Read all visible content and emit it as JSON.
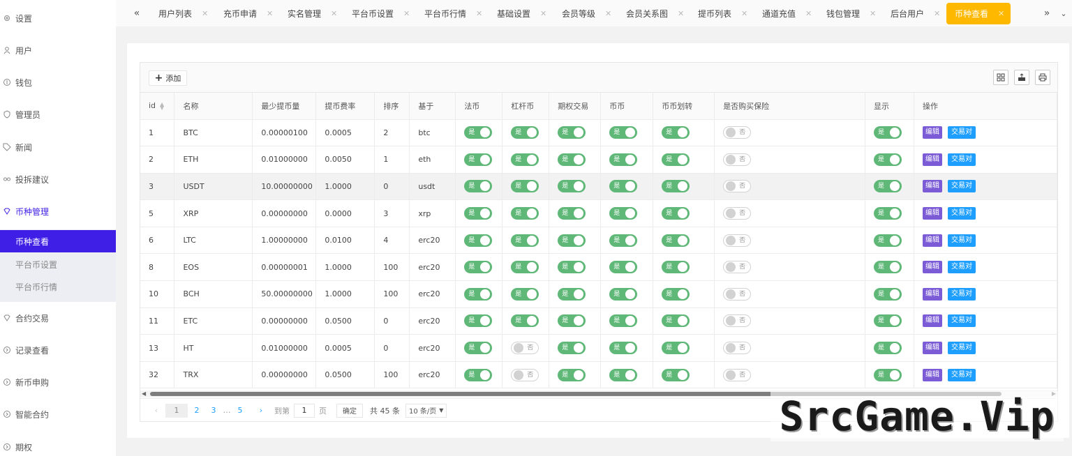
{
  "sidebar": {
    "items": [
      {
        "label": "设置",
        "icon": "gear-icon"
      },
      {
        "label": "用户",
        "icon": "user-icon"
      },
      {
        "label": "钱包",
        "icon": "wallet-icon"
      },
      {
        "label": "管理员",
        "icon": "shield-icon"
      },
      {
        "label": "新闻",
        "icon": "tag-icon"
      },
      {
        "label": "投拆建议",
        "icon": "link-icon"
      },
      {
        "label": "币种管理",
        "icon": "diamond-icon",
        "active": true
      },
      {
        "label": "合约交易",
        "icon": "diamond-icon"
      },
      {
        "label": "记录查看",
        "icon": "circle-arrow-icon"
      },
      {
        "label": "新币申购",
        "icon": "circle-arrow-icon"
      },
      {
        "label": "智能合约",
        "icon": "circle-arrow-icon"
      },
      {
        "label": "期权",
        "icon": "circle-arrow-icon"
      }
    ],
    "submenu": [
      {
        "label": "币种查看",
        "active": true
      },
      {
        "label": "平台币设置"
      },
      {
        "label": "平台币行情"
      }
    ]
  },
  "tabs": [
    "用户列表",
    "充币申请",
    "实名管理",
    "平台币设置",
    "平台币行情",
    "基础设置",
    "会员等级",
    "会员关系图",
    "提币列表",
    "通道充值",
    "钱包管理",
    "后台用户",
    "币种查看"
  ],
  "toolbar": {
    "add_label": "添加"
  },
  "table": {
    "headers": [
      "id",
      "名称",
      "最少提币量",
      "提币费率",
      "排序",
      "基于",
      "法币",
      "杠杆币",
      "期权交易",
      "币币",
      "币币划转",
      "是否购买保险",
      "显示",
      "操作"
    ],
    "switch_on": "是",
    "switch_off": "否",
    "edit_label": "编辑",
    "pair_label": "交易对",
    "rows": [
      {
        "id": "1",
        "name": "BTC",
        "min": "0.00000100",
        "fee": "0.0005",
        "sort": "2",
        "base": "btc",
        "fiat": true,
        "lever": true,
        "option": true,
        "coin": true,
        "transfer": true,
        "insurance": false,
        "show": true
      },
      {
        "id": "2",
        "name": "ETH",
        "min": "0.01000000",
        "fee": "0.0050",
        "sort": "1",
        "base": "eth",
        "fiat": true,
        "lever": true,
        "option": true,
        "coin": true,
        "transfer": true,
        "insurance": false,
        "show": true
      },
      {
        "id": "3",
        "name": "USDT",
        "min": "10.00000000",
        "fee": "1.0000",
        "sort": "0",
        "base": "usdt",
        "fiat": true,
        "lever": true,
        "option": true,
        "coin": true,
        "transfer": true,
        "insurance": false,
        "show": true
      },
      {
        "id": "5",
        "name": "XRP",
        "min": "0.00000000",
        "fee": "0.0000",
        "sort": "3",
        "base": "xrp",
        "fiat": true,
        "lever": true,
        "option": true,
        "coin": true,
        "transfer": true,
        "insurance": false,
        "show": true
      },
      {
        "id": "6",
        "name": "LTC",
        "min": "1.00000000",
        "fee": "0.0100",
        "sort": "4",
        "base": "erc20",
        "fiat": true,
        "lever": true,
        "option": true,
        "coin": true,
        "transfer": true,
        "insurance": false,
        "show": true
      },
      {
        "id": "8",
        "name": "EOS",
        "min": "0.00000001",
        "fee": "1.0000",
        "sort": "100",
        "base": "erc20",
        "fiat": true,
        "lever": true,
        "option": true,
        "coin": true,
        "transfer": true,
        "insurance": false,
        "show": true
      },
      {
        "id": "10",
        "name": "BCH",
        "min": "50.00000000",
        "fee": "1.0000",
        "sort": "100",
        "base": "erc20",
        "fiat": true,
        "lever": true,
        "option": true,
        "coin": true,
        "transfer": true,
        "insurance": false,
        "show": true
      },
      {
        "id": "11",
        "name": "ETC",
        "min": "0.00000000",
        "fee": "0.0500",
        "sort": "0",
        "base": "erc20",
        "fiat": true,
        "lever": true,
        "option": true,
        "coin": true,
        "transfer": true,
        "insurance": false,
        "show": true
      },
      {
        "id": "13",
        "name": "HT",
        "min": "0.01000000",
        "fee": "0.0005",
        "sort": "0",
        "base": "erc20",
        "fiat": true,
        "lever": false,
        "option": true,
        "coin": true,
        "transfer": true,
        "insurance": false,
        "show": true
      },
      {
        "id": "32",
        "name": "TRX",
        "min": "0.00000000",
        "fee": "0.0500",
        "sort": "100",
        "base": "erc20",
        "fiat": true,
        "lever": false,
        "option": true,
        "coin": true,
        "transfer": true,
        "insurance": false,
        "show": true
      }
    ]
  },
  "pager": {
    "pages": [
      "1",
      "2",
      "3",
      "…",
      "5"
    ],
    "goto_label": "到第",
    "goto_value": "1",
    "page_label": "页",
    "confirm_label": "确定",
    "total_label": "共 45 条",
    "per_page": "10 条/页"
  },
  "watermark": "SrcGame.Vip",
  "colors": {
    "accent": "#3f1ee6",
    "tab_active": "#ffb800",
    "switch_on": "#5fb878",
    "edit": "#7b5cd6",
    "pair": "#1e9fff"
  }
}
